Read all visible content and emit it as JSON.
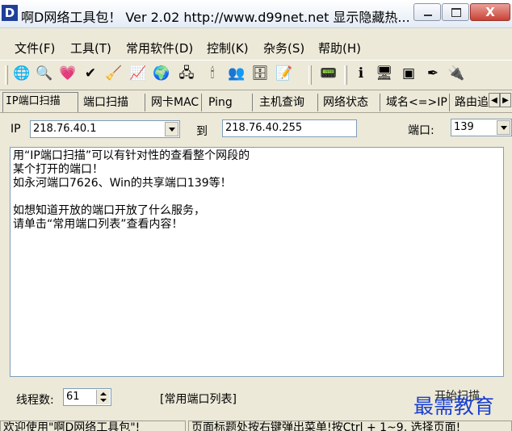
{
  "window": {
    "icon_letter": "D",
    "title": "啊D网络工具包！ Ver 2.02   http://www.d99net.net  显示隐藏热...",
    "close_glyph": "X"
  },
  "menu": [
    "文件(F)",
    "工具(T)",
    "常用软件(D)",
    "控制(K)",
    "杂务(S)",
    "帮助(H)"
  ],
  "toolbar": {
    "icons": [
      "globe-scan-icon",
      "magnifier-icon",
      "shield-heart-icon",
      "check-icon",
      "broom-icon",
      "chart-icon",
      "earth-icon",
      "network-computers-icon",
      "candle-icon",
      "users-icon",
      "server-icon",
      "notes-icon",
      "network-card-icon",
      "info-icon",
      "monitor-icon",
      "terminal-icon",
      "pen-icon",
      "chip-icon"
    ],
    "glyphs": [
      "🌐",
      "🔍",
      "💗",
      "✔",
      "🧹",
      "📈",
      "🌍",
      "🖧",
      "🕯",
      "👥",
      "🗄",
      "📝",
      "📟",
      "ℹ",
      "🖥",
      "▣",
      "✒",
      "🔌"
    ]
  },
  "tabs": [
    "IP端口扫描",
    "端口扫描",
    "网卡MAC",
    "Ping",
    "主机查询",
    "网络状态",
    "域名<=>IP",
    "路由追"
  ],
  "active_tab": "IP端口扫描",
  "form": {
    "ip_label": "IP",
    "ip_start": "218.76.40.1",
    "to_label": "到",
    "ip_end": "218.76.40.255",
    "port_label": "端口:",
    "port_value": "139"
  },
  "info_text": "用“IP端口扫描”可以有针对性的查看整个网段的\n某个打开的端口！\n如永河端口7626、Win的共享端口139等！\n\n如想知道开放的端口开放了什么服务，\n请单击“常用端口列表”查看内容！",
  "bottom": {
    "threads_label": "线程数:",
    "threads_value": "61",
    "port_list_label": "[常用端口列表]",
    "start_scan_label": "开始扫描"
  },
  "status": {
    "left": "欢迎使用\"啊D网络工具包\"!",
    "right": "页面标题处按右键弹出菜单!按Ctrl + 1~9, 选择页面!"
  },
  "watermark": "最需教育"
}
